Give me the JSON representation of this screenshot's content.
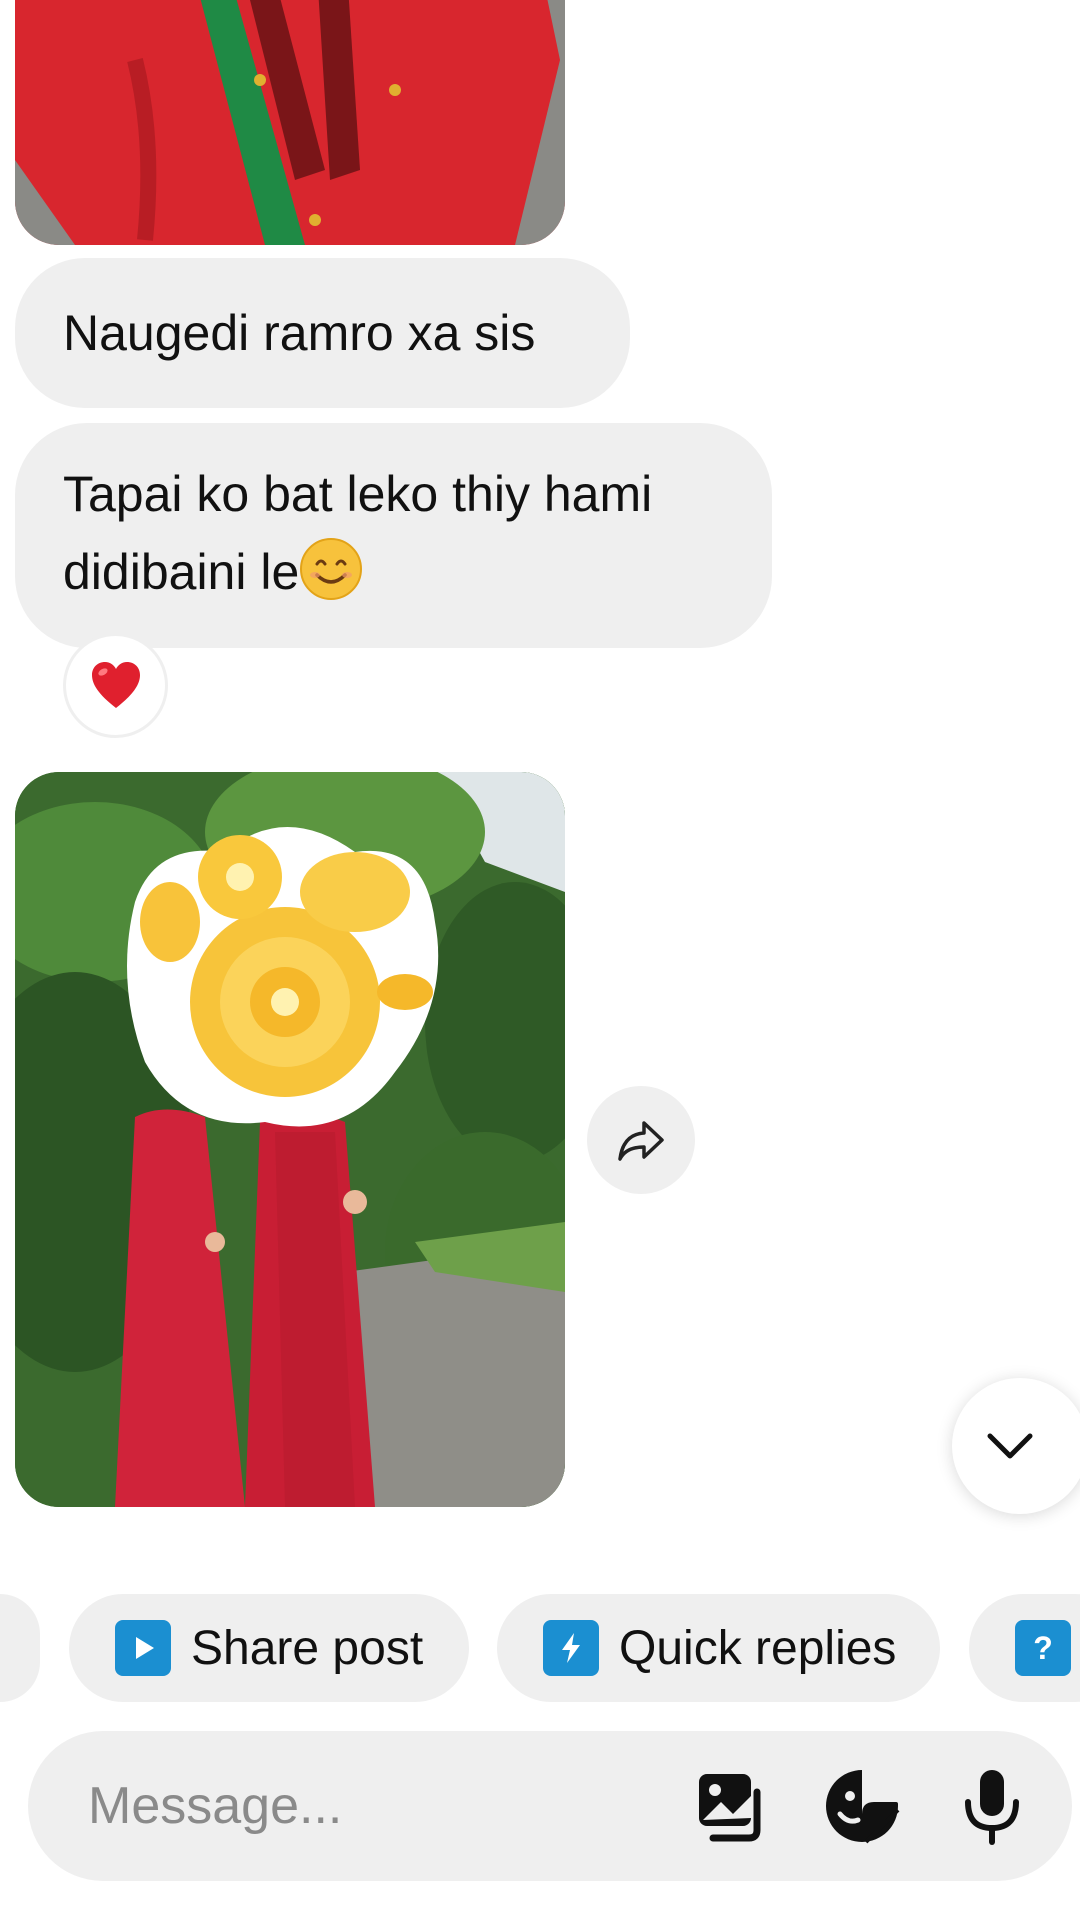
{
  "messages": [
    {
      "text": "Naugedi ramro xa sis"
    },
    {
      "text_line1": "Tapai ko bat leko thiy hami",
      "text_line2": "didibaini le"
    }
  ],
  "reaction_icon": "heart-icon",
  "quick_actions": [
    {
      "label": "Share post",
      "icon": "play-icon",
      "color": "#1b8fd1"
    },
    {
      "label": "Quick replies",
      "icon": "lightning-icon",
      "color": "#1b8fd1"
    },
    {
      "label": "",
      "icon": "question-icon",
      "color": "#1b8fd1"
    }
  ],
  "composer": {
    "placeholder": "Message...",
    "icons": [
      "gallery-icon",
      "sticker-icon",
      "microphone-icon"
    ]
  },
  "colors": {
    "bubble": "#efefef",
    "accent": "#1b8fd1",
    "heart": "#e0202e"
  }
}
